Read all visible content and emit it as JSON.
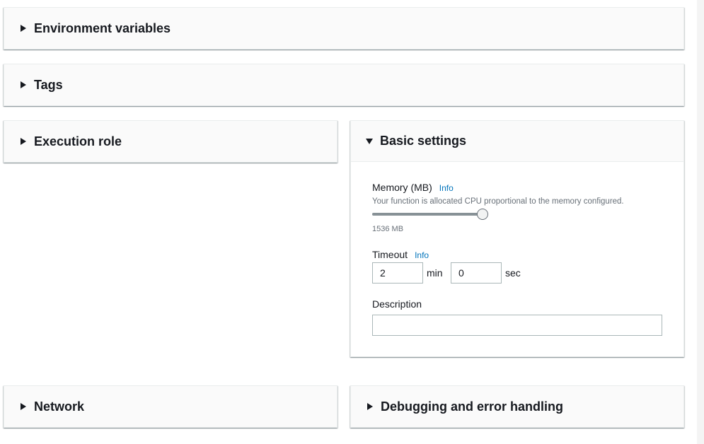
{
  "panels": {
    "environment_variables": {
      "title": "Environment variables",
      "expanded": false
    },
    "tags": {
      "title": "Tags",
      "expanded": false
    },
    "execution_role": {
      "title": "Execution role",
      "expanded": false
    },
    "basic_settings": {
      "title": "Basic settings",
      "expanded": true
    },
    "network": {
      "title": "Network",
      "expanded": false
    },
    "debugging": {
      "title": "Debugging and error handling",
      "expanded": false
    }
  },
  "basic_settings": {
    "memory": {
      "label": "Memory (MB)",
      "info": "Info",
      "description": "Your function is allocated CPU proportional to the memory configured.",
      "value_text": "1536 MB",
      "slider_fraction": 1.0
    },
    "timeout": {
      "label": "Timeout",
      "info": "Info",
      "minutes": "2",
      "min_unit": "min",
      "seconds": "0",
      "sec_unit": "sec"
    },
    "description": {
      "label": "Description",
      "value": ""
    }
  },
  "icons": {
    "collapsed": "caret-right-icon",
    "expanded": "caret-down-icon"
  }
}
